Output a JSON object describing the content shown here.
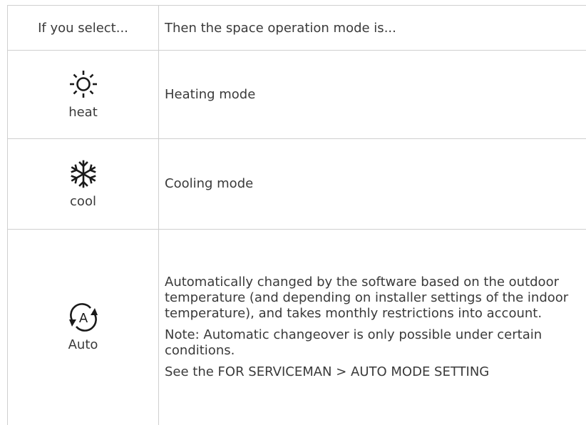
{
  "table": {
    "header": {
      "left": "If you select...",
      "right": "Then the space operation mode is..."
    },
    "rows": [
      {
        "icon": "sun-icon",
        "label": "heat",
        "description": "Heating mode"
      },
      {
        "icon": "snowflake-icon",
        "label": "cool",
        "description": "Cooling mode"
      },
      {
        "icon": "auto-cycle-icon",
        "icon_letter": "A",
        "label": "Auto",
        "description": "Automatically changed by the software based on the outdoor temperature (and depending on installer settings of the indoor temperature), and takes monthly restrictions into account.",
        "note": "Note: Automatic changeover is only possible under certain conditions.",
        "see": "See the FOR SERVICEMAN > AUTO MODE SETTING"
      }
    ]
  }
}
